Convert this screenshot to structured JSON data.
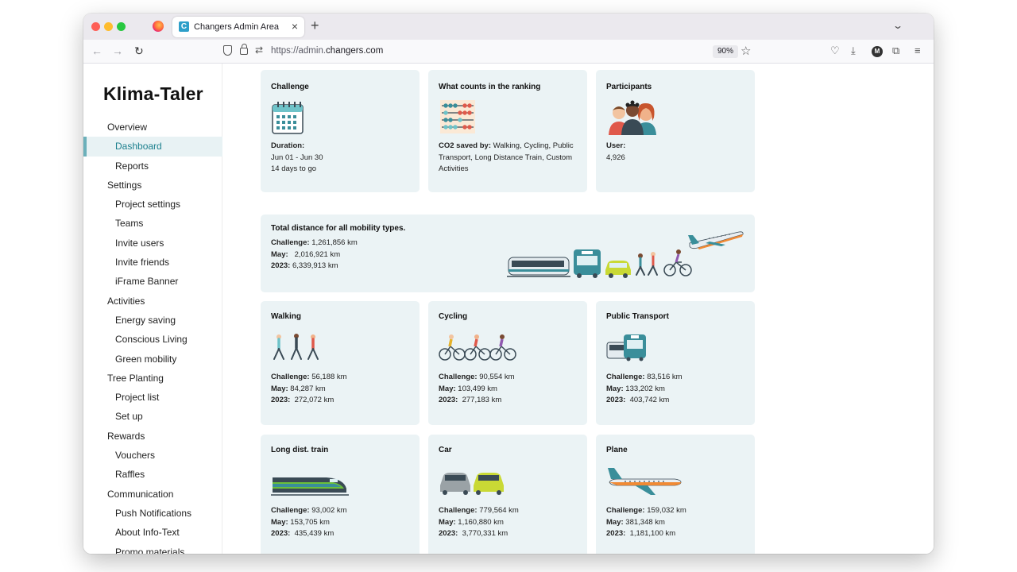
{
  "browser": {
    "tab_title": "Changers Admin Area",
    "tab_favicon": "C",
    "url_prefix": "https://admin.",
    "url_domain": "changers.com",
    "zoom": "90%",
    "account_initial": "M"
  },
  "sidebar": {
    "brand": "Klima-Taler",
    "items": [
      {
        "label": "Overview",
        "level": "section"
      },
      {
        "label": "Dashboard",
        "level": "sub",
        "active": true
      },
      {
        "label": "Reports",
        "level": "sub"
      },
      {
        "label": "Settings",
        "level": "section"
      },
      {
        "label": "Project settings",
        "level": "sub"
      },
      {
        "label": "Teams",
        "level": "sub"
      },
      {
        "label": "Invite users",
        "level": "sub"
      },
      {
        "label": "Invite friends",
        "level": "sub"
      },
      {
        "label": "iFrame Banner",
        "level": "sub"
      },
      {
        "label": "Activities",
        "level": "section"
      },
      {
        "label": "Energy saving",
        "level": "sub"
      },
      {
        "label": "Conscious Living",
        "level": "sub"
      },
      {
        "label": "Green mobility",
        "level": "sub"
      },
      {
        "label": "Tree Planting",
        "level": "section"
      },
      {
        "label": "Project list",
        "level": "sub"
      },
      {
        "label": "Set up",
        "level": "sub"
      },
      {
        "label": "Rewards",
        "level": "section"
      },
      {
        "label": "Vouchers",
        "level": "sub"
      },
      {
        "label": "Raffles",
        "level": "sub"
      },
      {
        "label": "Communication",
        "level": "section"
      },
      {
        "label": "Push Notifications",
        "level": "sub"
      },
      {
        "label": "About Info-Text",
        "level": "sub"
      },
      {
        "label": "Promo materials",
        "level": "sub"
      }
    ]
  },
  "challenge": {
    "title": "Challenge",
    "duration_label": "Duration:",
    "dates": "Jun 01 - Jun 30",
    "remaining": "14 days to go"
  },
  "ranking": {
    "title": "What counts in the ranking",
    "label": "CO2 saved by:",
    "text": " Walking, Cycling, Public Transport, Long Distance Train, Custom Activities"
  },
  "participants": {
    "title": "Participants",
    "user_label": "User:",
    "user_count": "4,926"
  },
  "total": {
    "title": "Total distance for all mobility types.",
    "challenge_label": "Challenge:",
    "challenge_value": " 1,261,856 km",
    "may_label": "May:",
    "may_value": "   2,016,921 km",
    "year_label": "2023:",
    "year_value": " 6,339,913 km"
  },
  "modes": [
    {
      "title": "Walking",
      "challenge": " 56,188 km",
      "may": " 84,287 km",
      "year": "  272,072 km"
    },
    {
      "title": "Cycling",
      "challenge": " 90,554 km",
      "may": " 103,499 km",
      "year": "  277,183 km"
    },
    {
      "title": "Public Transport",
      "challenge": " 83,516 km",
      "may": " 133,202 km",
      "year": "  403,742 km"
    },
    {
      "title": "Long dist. train",
      "challenge": " 93,002 km",
      "may": " 153,705 km",
      "year": "  435,439 km"
    },
    {
      "title": "Car",
      "challenge": " 779,564 km",
      "may": " 1,160,880 km",
      "year": "  3,770,331 km"
    },
    {
      "title": "Plane",
      "challenge": " 159,032 km",
      "may": " 381,348 km",
      "year": "  1,181,100 km"
    }
  ],
  "labels": {
    "challenge": "Challenge:",
    "may": "May:",
    "year": "2023:"
  },
  "colors": {
    "card_bg": "#ebf3f5",
    "active_bg": "#e8f2f4",
    "active_text": "#1b7f8d",
    "accent": "#6bb0ba"
  }
}
